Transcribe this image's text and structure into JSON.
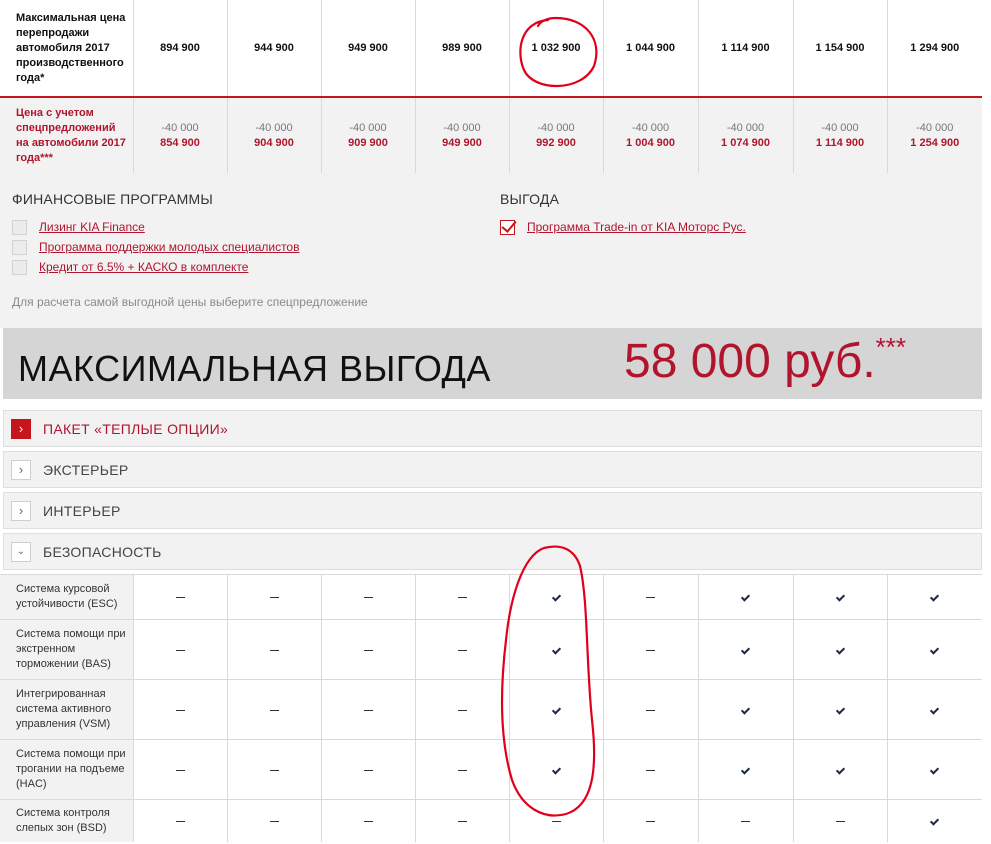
{
  "price_rows": {
    "max_price": {
      "label": "Максимальная цена перепродажи автомобиля 2017 производственного года*",
      "values": [
        "894 900",
        "944 900",
        "949 900",
        "989 900",
        "1 032 900",
        "1 044 900",
        "1 114 900",
        "1 154 900",
        "1 294 900"
      ]
    },
    "special_price": {
      "label": "Цена с учетом спецпредложений на автомобили 2017 года***",
      "discounts": [
        "-40 000",
        "-40 000",
        "-40 000",
        "-40 000",
        "-40 000",
        "-40 000",
        "-40 000",
        "-40 000",
        "-40 000"
      ],
      "values": [
        "854 900",
        "904 900",
        "909 900",
        "949 900",
        "992 900",
        "1 004 900",
        "1 074 900",
        "1 114 900",
        "1 254 900"
      ]
    }
  },
  "finance": {
    "title": "ФИНАНСОВЫЕ ПРОГРАММЫ",
    "options": [
      {
        "label": "Лизинг KIA Finance",
        "checked": false
      },
      {
        "label": "Программа поддержки молодых специалистов",
        "checked": false
      },
      {
        "label": "Кредит от 6.5% + КАСКО в комплекте",
        "checked": false
      }
    ]
  },
  "benefit_programs": {
    "title": "ВЫГОДА",
    "options": [
      {
        "label": "Программа Trade-in от KIA Моторс Рус.",
        "checked": true
      }
    ]
  },
  "hint": "Для расчета самой выгодной цены выберите спецпредложение",
  "max_benefit": {
    "label": "МАКСИМАЛЬНАЯ ВЫГОДА",
    "value": "58 000 руб.",
    "mark": "***"
  },
  "accordion": [
    {
      "title": "ПАКЕТ «ТЕПЛЫЕ ОПЦИИ»",
      "active": true,
      "icon": "chevron-right-icon"
    },
    {
      "title": "ЭКСТЕРЬЕР",
      "active": false,
      "icon": "chevron-right-icon"
    },
    {
      "title": "ИНТЕРЬЕР",
      "active": false,
      "icon": "chevron-right-icon"
    },
    {
      "title": "БЕЗОПАСНОСТЬ",
      "active": false,
      "icon": "chevron-down-icon"
    }
  ],
  "safety_features": [
    {
      "label": "Система курсовой устойчивости (ESC)",
      "cells": [
        "dash",
        "dash",
        "dash",
        "dash",
        "check",
        "dash",
        "check",
        "check",
        "check"
      ]
    },
    {
      "label": "Система помощи при экстренном торможении (BAS)",
      "cells": [
        "dash",
        "dash",
        "dash",
        "dash",
        "check",
        "dash",
        "check",
        "check",
        "check"
      ]
    },
    {
      "label": "Интегрированная система активного управления (VSM)",
      "cells": [
        "dash",
        "dash",
        "dash",
        "dash",
        "check",
        "dash",
        "check",
        "check",
        "check"
      ]
    },
    {
      "label": "Система помощи при трогании на подъеме (HAC)",
      "cells": [
        "dash",
        "dash",
        "dash",
        "dash",
        "check",
        "dash",
        "check",
        "check",
        "check"
      ]
    },
    {
      "label": "Система контроля слепых зон (BSD)",
      "cells": [
        "dash",
        "dash",
        "dash",
        "dash",
        "dash",
        "dash",
        "dash",
        "dash",
        "check"
      ]
    }
  ],
  "colors": {
    "accent": "#c4161c",
    "price_red": "#b0152d",
    "annotation": "#e0001b",
    "check": "#1e2b45"
  }
}
